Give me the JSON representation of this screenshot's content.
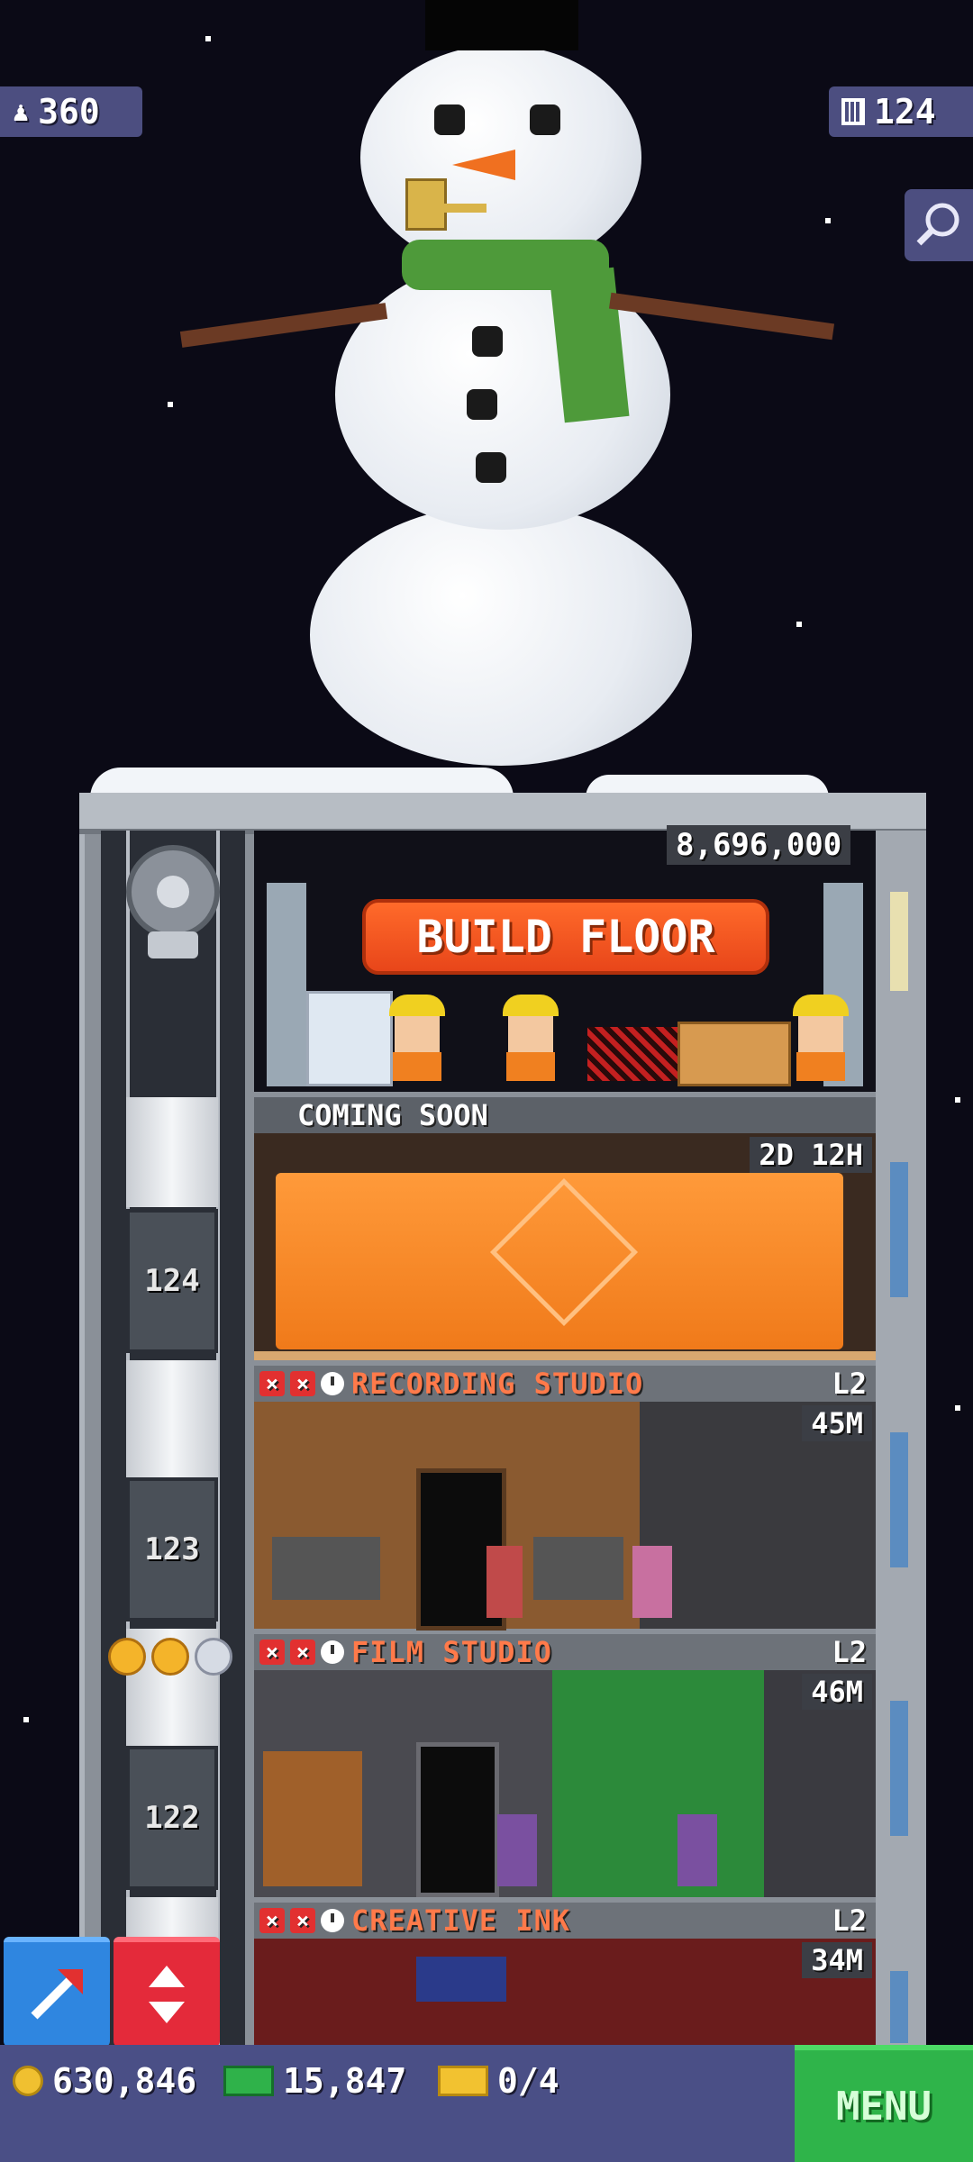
{
  "hud": {
    "population": "360",
    "floors": "124",
    "population_icon": "person-icon",
    "floors_icon": "building-icon",
    "zoom_icon": "magnifier-icon"
  },
  "top_floor": {
    "build_cost": "8,696,000",
    "build_label": "BUILD FLOOR"
  },
  "construction": {
    "label": "COMING SOON",
    "timer": "2D 12H"
  },
  "floors": [
    {
      "number": "124"
    },
    {
      "number": "123",
      "name": "RECORDING STUDIO",
      "level": "L2",
      "timer": "45M"
    },
    {
      "number": "122",
      "name": "FILM STUDIO",
      "level": "L2",
      "timer": "46M"
    },
    {
      "name": "CREATIVE INK",
      "level": "L2",
      "timer": "34M"
    }
  ],
  "elevator_rating": {
    "filled": 2,
    "total": 3
  },
  "bottom_bar": {
    "coins": "630,846",
    "bux": "15,847",
    "tickets": "0/4",
    "menu_label": "MENU"
  },
  "colors": {
    "sky": "#0b0a16",
    "hud": "#4c4e80",
    "accent_orange": "#ff7a4a",
    "menu_green": "#2fb44a",
    "stop_red": "#e23030"
  }
}
